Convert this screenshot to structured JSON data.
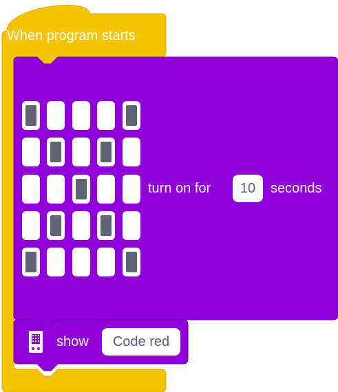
{
  "hat_block": {
    "label": "When program starts"
  },
  "display_block": {
    "grid": [
      [
        1,
        0,
        0,
        0,
        1
      ],
      [
        0,
        1,
        0,
        1,
        0
      ],
      [
        0,
        0,
        1,
        0,
        0
      ],
      [
        0,
        1,
        0,
        1,
        0
      ],
      [
        1,
        0,
        0,
        0,
        1
      ]
    ],
    "text_before": "turn on for",
    "duration": "10",
    "text_after": "seconds"
  },
  "show_block": {
    "icon": "microbit-board-icon",
    "label": "show",
    "value": "Code red"
  },
  "colors": {
    "hat_yellow": "#f5c400",
    "hat_yellow_dark": "#d9a900",
    "block_purple": "#9100d9",
    "block_purple_dark": "#6e00a8",
    "led_on": "#5f6473"
  }
}
